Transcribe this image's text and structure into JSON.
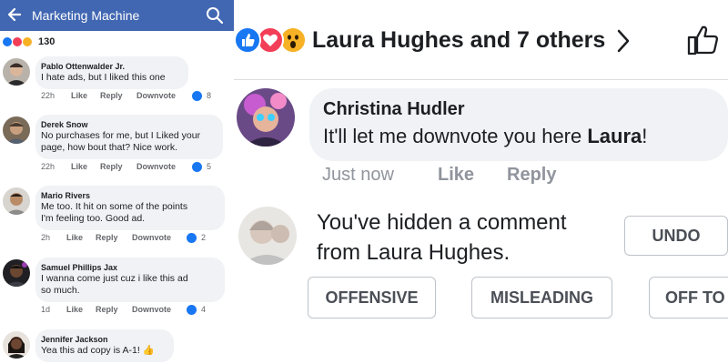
{
  "left": {
    "header": {
      "title": "Marketing Machine",
      "back_icon": "back-arrow-icon",
      "search_icon": "search-icon",
      "bg": "#4267b2"
    },
    "reactions": {
      "count": "130"
    },
    "comments": [
      {
        "name": "Pablo Ottenwalder Jr.",
        "lines": [
          "I hate ads, but I liked this one"
        ],
        "time": "22h",
        "like": "Like",
        "reply": "Reply",
        "downvote": "Downvote",
        "count": "8"
      },
      {
        "name": "Derek Snow",
        "lines": [
          "No purchases for me, but I Liked your",
          "page, how bout that? Nice work."
        ],
        "time": "22h",
        "like": "Like",
        "reply": "Reply",
        "downvote": "Downvote",
        "count": "5"
      },
      {
        "name": "Mario Rivers",
        "lines": [
          "Me too. It hit on some of the points",
          "I'm feeling too. Good ad."
        ],
        "time": "2h",
        "like": "Like",
        "reply": "Reply",
        "downvote": "Downvote",
        "count": "2"
      },
      {
        "name": "Samuel Phillips Jax",
        "lines": [
          "I wanna come just cuz i like this ad",
          "so much."
        ],
        "time": "1d",
        "like": "Like",
        "reply": "Reply",
        "downvote": "Downvote",
        "count": "4"
      },
      {
        "name": "Jennifer Jackson",
        "lines": [
          "Yea this ad copy is A-1! 👍"
        ]
      }
    ]
  },
  "right": {
    "reactors": "Laura Hughes and 7 others",
    "comment": {
      "name": "Christina Hudler",
      "text_prefix": "It'll let me downvote you here ",
      "text_bold": "Laura",
      "text_suffix": "!",
      "time": "Just now",
      "like": "Like",
      "reply": "Reply"
    },
    "hidden": {
      "line1": "You've hidden a comment",
      "line2": "from Laura Hughes.",
      "undo": "UNDO"
    },
    "reasons": [
      "OFFENSIVE",
      "MISLEADING",
      "OFF TO"
    ]
  },
  "colors": {
    "like": "#1877f2",
    "love": "#f33e58",
    "wow": "#f7b125",
    "bubble": "#f0f2f5",
    "muted": "#65676b"
  }
}
